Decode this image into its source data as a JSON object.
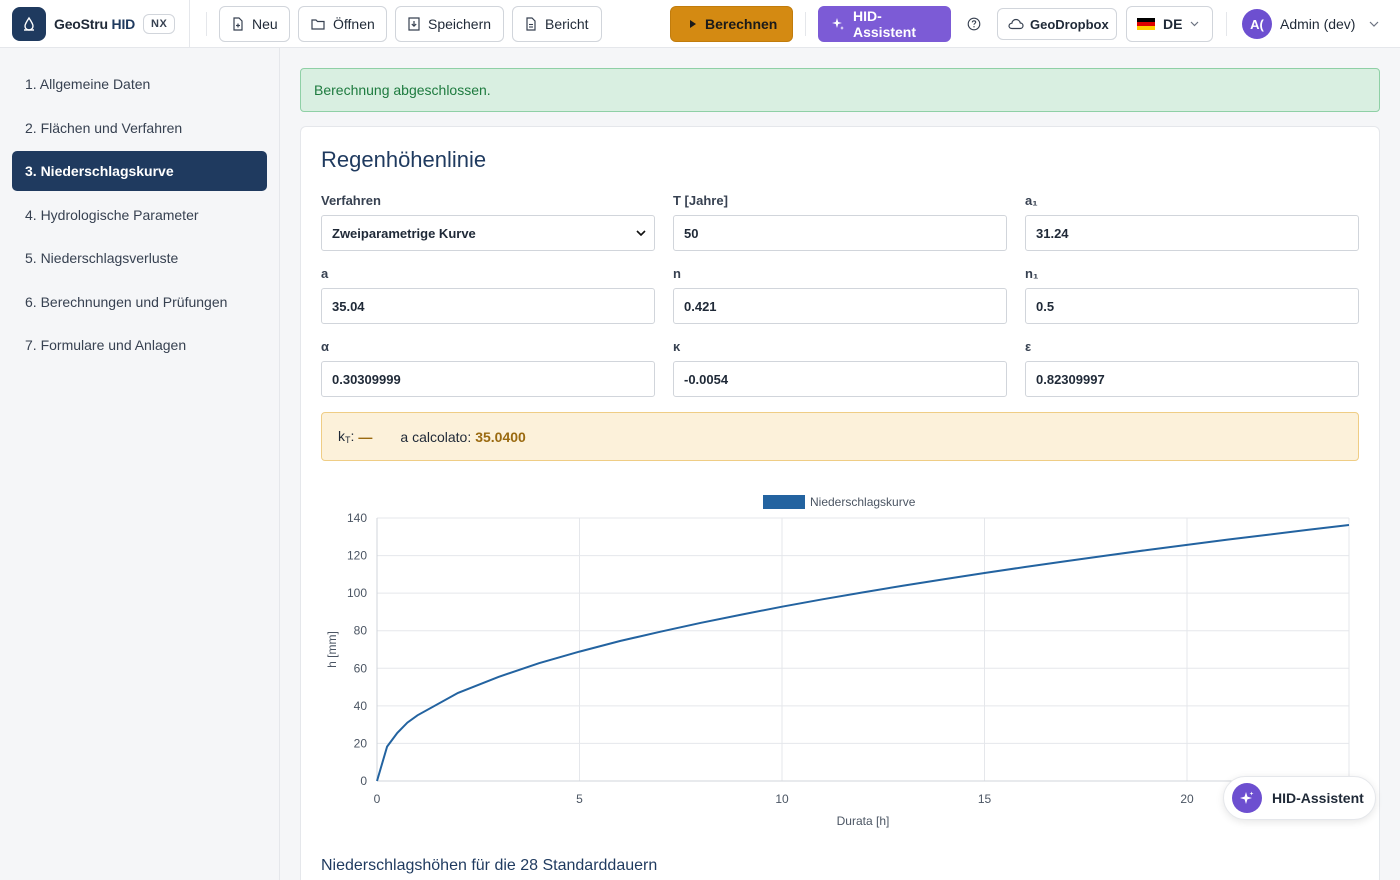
{
  "brand": {
    "name_prefix": "GeoStru",
    "name_suffix": "HID",
    "badge": "NX"
  },
  "toolbar": {
    "new": "Neu",
    "open": "Öffnen",
    "save": "Speichern",
    "report": "Bericht",
    "calculate": "Berechnen",
    "assistant": "HID-Assistent",
    "dropbox": "GeoDropbox",
    "language": "DE",
    "user": "Admin (dev)",
    "avatar_initials": "A("
  },
  "sidebar": {
    "items": [
      {
        "label": "1. Allgemeine Daten"
      },
      {
        "label": "2. Flächen und Verfahren"
      },
      {
        "label": "3. Niederschlagskurve",
        "active": true
      },
      {
        "label": "4. Hydrologische Parameter"
      },
      {
        "label": "5. Niederschlagsverluste"
      },
      {
        "label": "6. Berechnungen und Prüfungen"
      },
      {
        "label": "7. Formulare und Anlagen"
      }
    ]
  },
  "alert": {
    "text": "Berechnung abgeschlossen."
  },
  "card": {
    "title": "Regenhöhenlinie",
    "fields": {
      "method": {
        "label": "Verfahren",
        "value": "Zweiparametrige Kurve"
      },
      "T": {
        "label": "T [Jahre]",
        "value": "50"
      },
      "a1": {
        "label": "a₁",
        "value": "31.24"
      },
      "a": {
        "label": "a",
        "value": "35.04"
      },
      "n": {
        "label": "n",
        "value": "0.421"
      },
      "n1": {
        "label": "n₁",
        "value": "0.5"
      },
      "alpha": {
        "label": "α",
        "value": "0.30309999"
      },
      "kappa": {
        "label": "κ",
        "value": "-0.0054"
      },
      "epsilon": {
        "label": "ε",
        "value": "0.82309997"
      }
    },
    "info": {
      "kt_label": "k",
      "kt_sub": "T",
      "kt_value": "—",
      "a_calc_label": "a calcolato:",
      "a_calc_value": "35.0400"
    },
    "section_title": "Niederschlagshöhen für die 28 Standarddauern"
  },
  "chart_data": {
    "type": "line",
    "title": "",
    "xlabel": "Durata [h]",
    "ylabel": "h [mm]",
    "xlim": [
      0,
      24
    ],
    "ylim": [
      0,
      140
    ],
    "x_ticks": [
      0,
      5,
      10,
      15,
      20
    ],
    "y_ticks": [
      0,
      20,
      40,
      60,
      80,
      100,
      120,
      140
    ],
    "grid": true,
    "legend": "top-center",
    "series": [
      {
        "name": "Niederschlagskurve",
        "color": "#2363a0",
        "x": [
          0,
          0.25,
          0.5,
          0.75,
          1,
          2,
          3,
          4,
          5,
          6,
          7,
          8,
          9,
          10,
          11,
          12,
          13,
          14,
          15,
          16,
          17,
          18,
          19,
          20,
          21,
          22,
          23,
          24
        ],
        "y": [
          0,
          18.3,
          25.6,
          31.1,
          35.0,
          46.9,
          55.4,
          62.7,
          68.9,
          74.5,
          79.5,
          84.2,
          88.6,
          92.8,
          96.7,
          100.4,
          104.0,
          107.4,
          110.7,
          113.9,
          117.0,
          120.0,
          122.9,
          125.7,
          128.5,
          131.1,
          133.7,
          136.3
        ]
      }
    ]
  },
  "fab": {
    "label": "HID-Assistent"
  },
  "colors": {
    "primary": "#1f3a5f",
    "calculate": "#d48a12",
    "assistant": "#7c5bd6",
    "success_bg": "#d9efe1",
    "warning_bg": "#fcf1da"
  }
}
